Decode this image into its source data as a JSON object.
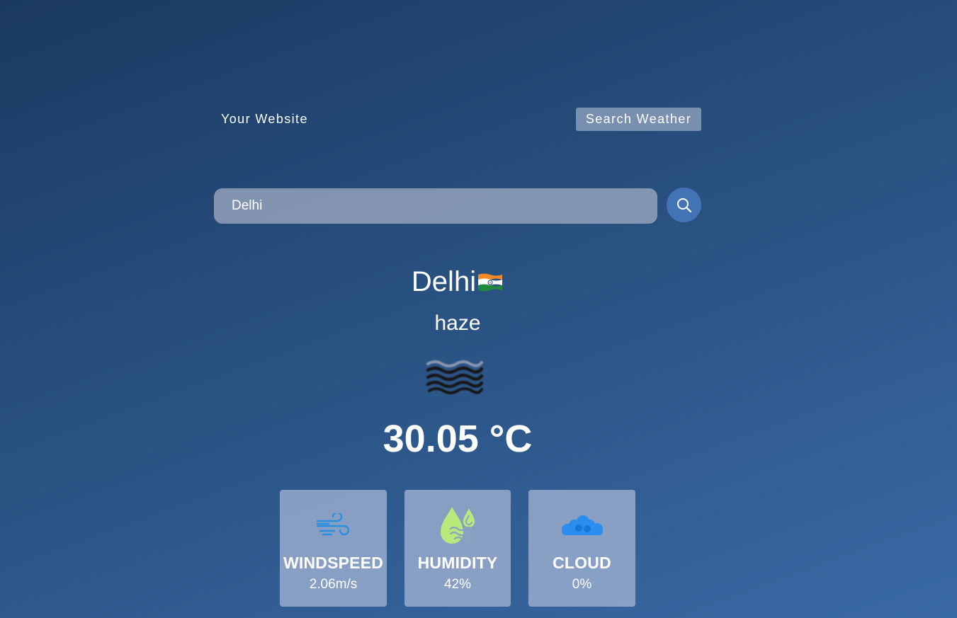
{
  "nav": {
    "brand": "Your Website",
    "button_label": "Search Weather"
  },
  "search": {
    "value": "Delhi",
    "placeholder": "",
    "button_icon": "search-icon"
  },
  "weather": {
    "city": "Delhi",
    "flag_icon": "india-flag-icon",
    "description": "haze",
    "condition_icon": "haze-icon",
    "temperature": "30.05 °C"
  },
  "stats": [
    {
      "icon": "wind-icon",
      "label": "WINDSPEED",
      "value": "2.06m/s"
    },
    {
      "icon": "humidity-drops-icon",
      "label": "HUMIDITY",
      "value": "42%"
    },
    {
      "icon": "cloud-icon",
      "label": "CLOUD",
      "value": "0%"
    }
  ],
  "colors": {
    "background_top": "#1b3961",
    "background_bottom": "#3a6aa6",
    "search_button": "#4273b4",
    "wind_icon": "#2b8fe0",
    "humidity_icon": "#b6ea7c",
    "cloud_icon": "#2a8ef0"
  }
}
